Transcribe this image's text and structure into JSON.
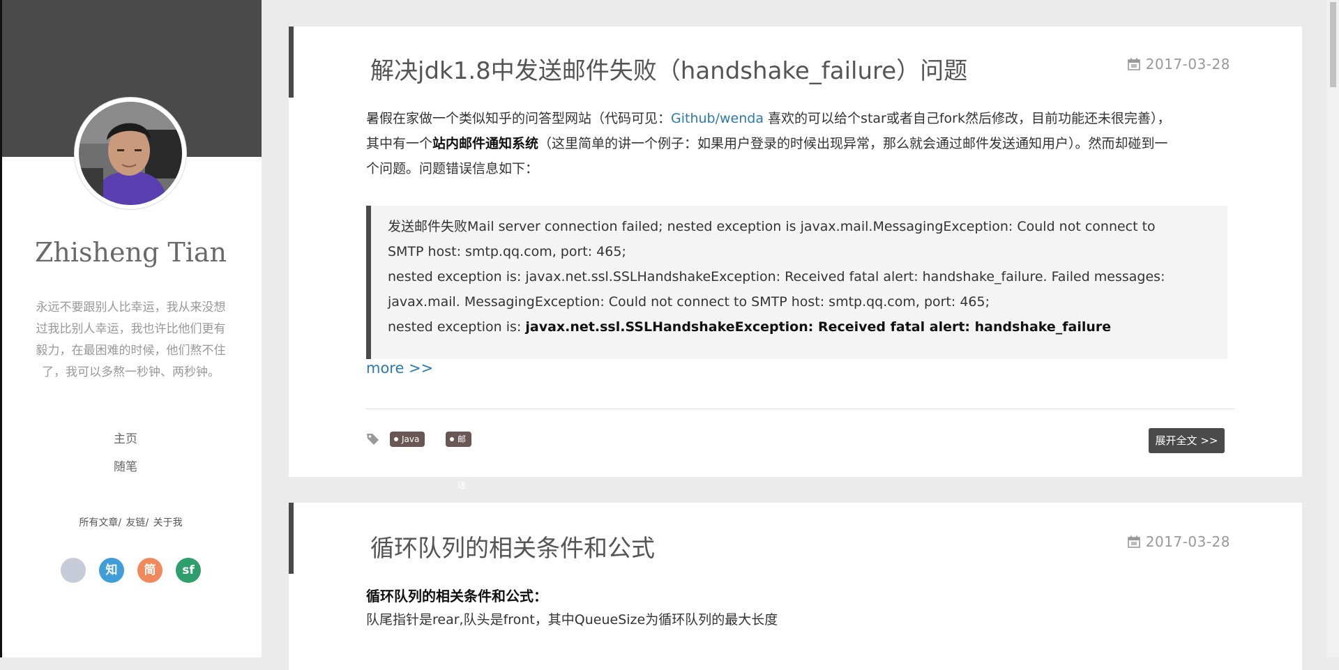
{
  "sidebar": {
    "author_name": "Zhisheng Tian",
    "motto_lines": [
      "永远不要跟别人比幸运，我从来没想",
      "过我比别人幸运，我也许比他们更有",
      "毅力，在最困难的时候，他们熬不住",
      "了，我可以多熬一秒钟、两秒钟。"
    ],
    "nav": [
      "主页",
      "随笔"
    ],
    "footer_links": [
      "所有文章/",
      "友链/",
      "关于我"
    ],
    "social": [
      {
        "icon": "github-icon",
        "glyph": "",
        "color": "#c8ccd8"
      },
      {
        "icon": "zhihu-icon",
        "glyph": "知",
        "color": "#3f9ed8"
      },
      {
        "icon": "jianshu-icon",
        "glyph": "简",
        "color": "#f08a5d"
      },
      {
        "icon": "segmentfault-icon",
        "glyph": "sf",
        "color": "#2e9e6d"
      }
    ]
  },
  "posts": [
    {
      "title": "解决jdk1.8中发送邮件失败（handshake_failure）问题",
      "date": "2017-03-28",
      "intro": {
        "p1": "暑假在家做一个类似知乎的问答型网站（代码可见：",
        "link": "Github/wenda",
        "p2": " 喜欢的可以给个star或者自己fork然后修改，目前功能还未很完善），",
        "p3": "其中有一个",
        "bold": "站内邮件通知系统",
        "p4": "（这里简单的讲一个例子：如果用户登录的时候出现异常，那么就会通过邮件发送通知用户）。然而却碰到一",
        "p5": "个问题。问题错误信息如下："
      },
      "quote": {
        "l1": "发送邮件失败Mail server connection failed; nested exception is javax.mail.MessagingException: Could not connect to",
        "l2": "SMTP host: smtp.qq.com, port: 465;",
        "l3": "nested exception is: javax.net.ssl.SSLHandshakeException: Received fatal alert: handshake_failure. Failed messages:",
        "l4": "javax.mail. MessagingException: Could not connect to SMTP host: smtp.qq.com, port: 465;",
        "l5_prefix": "nested exception is: ",
        "l5_bold": "javax.net.ssl.SSLHandshakeException: Received fatal alert: handshake_failure"
      },
      "more": "more >>",
      "tags": [
        "Java",
        "邮件发送"
      ],
      "expand": "展开全文 >>"
    },
    {
      "title": "循环队列的相关条件和公式",
      "date": "2017-03-28",
      "heading": "循环队列的相关条件和公式：",
      "line1": "队尾指针是rear,队头是front，其中QueueSize为循环队列的最大长度"
    }
  ],
  "colors": {
    "sidebar_banner": "#4a4a4a",
    "link": "#2a7ab0",
    "tag_bg": "#6b5656",
    "page_bg": "#ebebeb"
  }
}
